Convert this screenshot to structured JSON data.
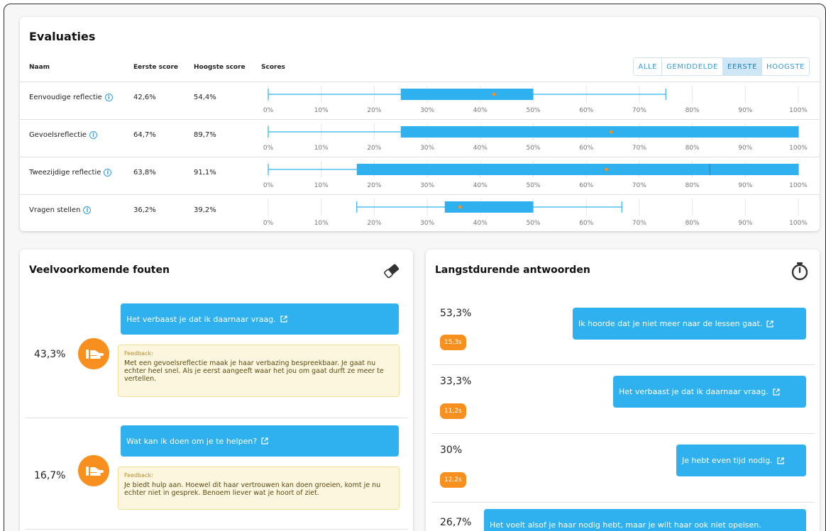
{
  "evaluaties": {
    "title": "Evaluaties",
    "columns": {
      "name": "Naam",
      "first": "Eerste score",
      "high": "Hoogste score",
      "scores": "Scores"
    },
    "filter": {
      "options": [
        "ALLE",
        "GEMIDDELDE",
        "EERSTE",
        "HOOGSTE"
      ],
      "selected": "EERSTE"
    },
    "axis_ticks": [
      "0%",
      "10%",
      "20%",
      "30%",
      "40%",
      "50%",
      "60%",
      "70%",
      "80%",
      "90%",
      "100%"
    ],
    "rows": [
      {
        "name": "Eenvoudige reflectie",
        "first": "42,6%",
        "high": "54,4%"
      },
      {
        "name": "Gevoelsreflectie",
        "first": "64,7%",
        "high": "89,7%"
      },
      {
        "name": "Tweezijdige reflectie",
        "first": "63,8%",
        "high": "91,1%"
      },
      {
        "name": "Vragen stellen",
        "first": "36,2%",
        "high": "39,2%"
      }
    ]
  },
  "chart_data": {
    "type": "boxplot",
    "xlim": [
      0,
      100
    ],
    "series": [
      {
        "name": "Eenvoudige reflectie",
        "whisker_low": 0,
        "q1": 25,
        "q3": 50,
        "whisker_high": 75,
        "mean": 42.6
      },
      {
        "name": "Gevoelsreflectie",
        "whisker_low": 0,
        "q1": 25,
        "q3": 100,
        "whisker_high": 100,
        "mean": 64.7
      },
      {
        "name": "Tweezijdige reflectie",
        "whisker_low": 0,
        "q1": 16.7,
        "median": 83.3,
        "q3": 100,
        "whisker_high": 100,
        "mean": 63.8
      },
      {
        "name": "Vragen stellen",
        "whisker_low": 16.7,
        "q1": 33.3,
        "q3": 50,
        "whisker_high": 66.7,
        "mean": 36.2
      }
    ]
  },
  "errors": {
    "title": "Veelvoorkomende fouten",
    "icon": "eraser-icon",
    "items": [
      {
        "pct": "43,3%",
        "answer": "Het verbaast je dat ik daarnaar vraag.",
        "feedback_label": "Feedback:",
        "feedback": "Met een gevoelsreflectie maak je haar verbazing bespreekbaar. Je gaat nu echter heel snel. Als je eerst aangeeft waar het jou om gaat durft ze meer te vertellen."
      },
      {
        "pct": "16,7%",
        "answer": "Wat kan ik doen om je te helpen?",
        "feedback_label": "Feedback:",
        "feedback": "Je biedt hulp aan. Hoewel dit haar vertrouwen kan doen groeien, komt je nu echter niet in gesprek. Benoem liever wat je hoort of ziet."
      }
    ]
  },
  "longest": {
    "title": "Langstdurende antwoorden",
    "icon": "stopwatch-icon",
    "items": [
      {
        "pct": "53,3%",
        "time": "15,3s",
        "answer": "Ik hoorde dat je niet meer naar de lessen gaat."
      },
      {
        "pct": "33,3%",
        "time": "11,2s",
        "answer": "Het verbaast je dat ik daarnaar vraag."
      },
      {
        "pct": "30%",
        "time": "12,2s",
        "answer": "Je hebt even tijd nodig."
      },
      {
        "pct": "26,7%",
        "time": "",
        "answer": "Het voelt alsof je haar nodig hebt, maar je wilt haar ook niet opeisen."
      }
    ]
  },
  "colors": {
    "accent": "#2fb1ef",
    "orange": "#f7901e",
    "feedback_bg": "#fdf6de"
  }
}
